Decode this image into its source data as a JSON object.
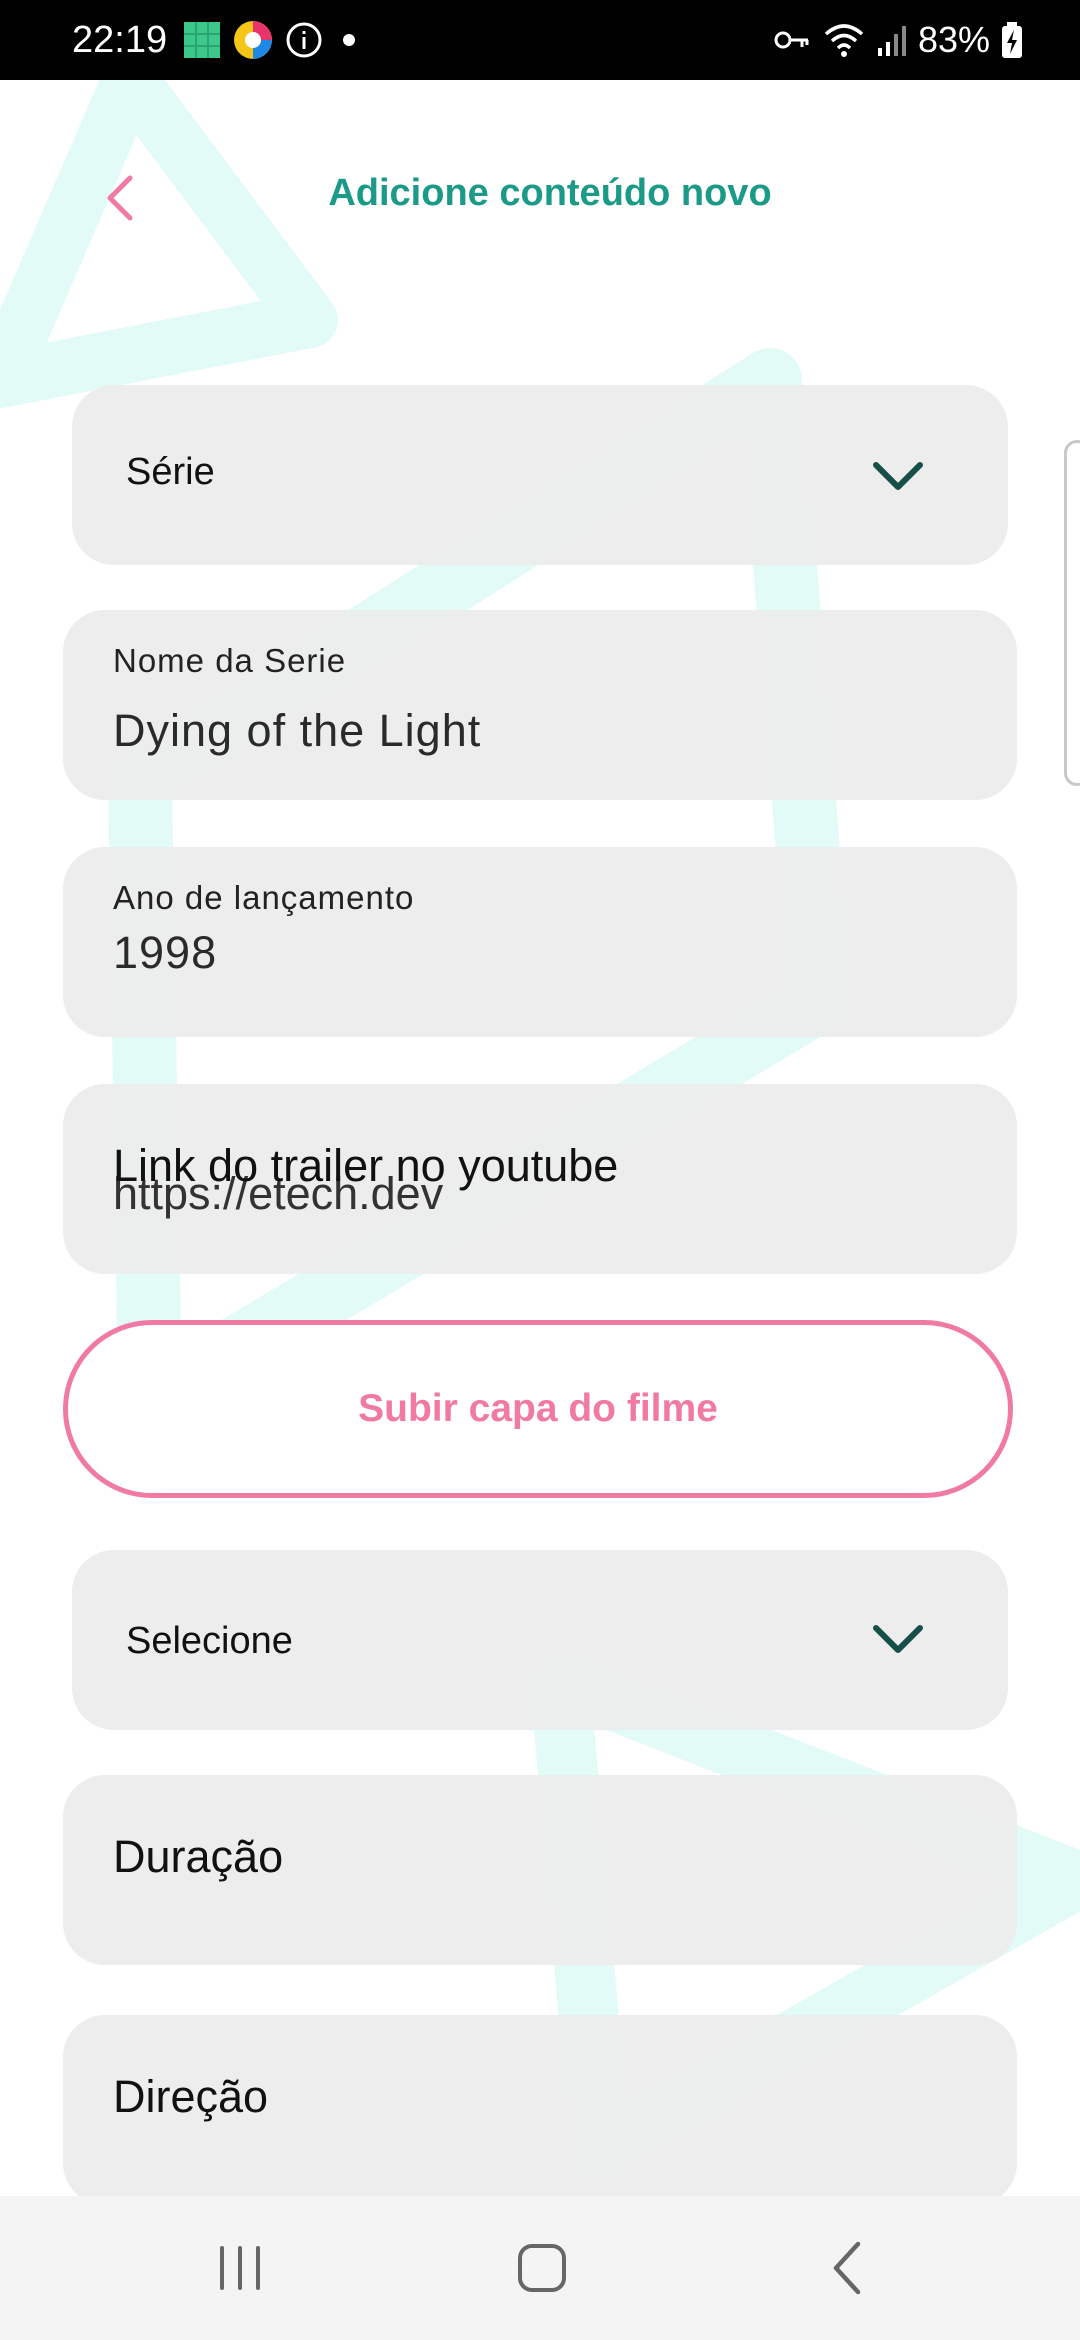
{
  "status_bar": {
    "time": "22:19",
    "battery": "83%",
    "left_icons": [
      "gallery-icon",
      "color-app-icon",
      "info-icon",
      "dot-icon"
    ],
    "right_icons": [
      "key-icon",
      "wifi-icon",
      "signal-icon",
      "battery-charging-icon"
    ]
  },
  "header": {
    "title": "Adicione conteúdo novo",
    "back_icon": "chevron-left-icon"
  },
  "form": {
    "type_select": {
      "value": "Série"
    },
    "name_field": {
      "label": "Nome da Serie",
      "value": "Dying of the Light"
    },
    "year_field": {
      "label": "Ano de lançamento",
      "value": "1998"
    },
    "trailer_field": {
      "placeholder": "Link do trailer no youtube",
      "value": "https://etech.dev"
    },
    "upload_button": {
      "label": "Subir capa do filme"
    },
    "category_select": {
      "value": "Selecione"
    },
    "duration_field": {
      "placeholder": "Duração"
    },
    "director_field": {
      "placeholder": "Direção"
    }
  },
  "nav_bar": {
    "buttons": [
      "recent-apps-icon",
      "home-icon",
      "back-icon"
    ]
  },
  "colors": {
    "accent_teal": "#1a9a87",
    "accent_pink": "#f07aa3",
    "field_bg": "#ececec",
    "bg_shape": "#e3fbf7",
    "chevron_dark": "#164f4a"
  }
}
